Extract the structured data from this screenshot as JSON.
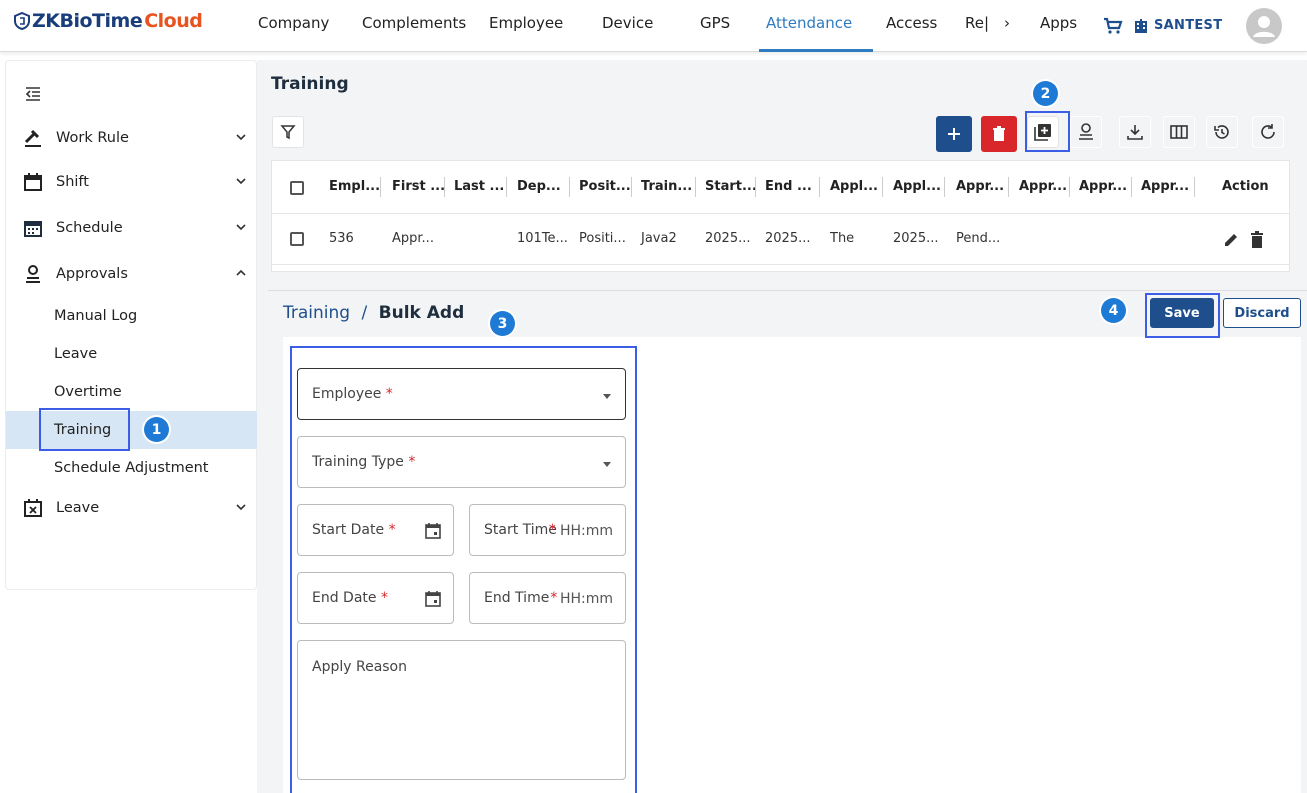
{
  "logo": {
    "part1": "ZKBioTime",
    "part2": "Cloud"
  },
  "nav": {
    "items": [
      "Company",
      "Complements",
      "Employee",
      "Device",
      "GPS",
      "Attendance",
      "Access",
      "Re|",
      "Apps"
    ],
    "more": "›",
    "company": "SANTEST",
    "active": "Attendance",
    "accent_color": "#2f7bbf"
  },
  "sidebar": {
    "groups": [
      {
        "label": "Work Rule",
        "icon": "gavel-icon"
      },
      {
        "label": "Shift",
        "icon": "calendar-blank-icon"
      },
      {
        "label": "Schedule",
        "icon": "calendar-grid-icon"
      },
      {
        "label": "Approvals",
        "icon": "user-stamp-icon"
      }
    ],
    "sub_items": [
      "Manual Log",
      "Leave",
      "Overtime",
      "Training",
      "Schedule Adjustment"
    ],
    "active_sub": "Training",
    "leave": {
      "label": "Leave",
      "icon": "calendar-x-icon"
    }
  },
  "main": {
    "title": "Training",
    "columns": [
      "Empl...",
      "First ...",
      "Last ...",
      "Dep...",
      "Posit...",
      "Train...",
      "Start...",
      "End ...",
      "Appl...",
      "Appl...",
      "Appr...",
      "Appr...",
      "Appr...",
      "Appr...",
      "Action"
    ],
    "rows": [
      [
        "536",
        "Appr...",
        "",
        "101Te...",
        "Positi...",
        "Java2",
        "2025...",
        "2025...",
        "The",
        "2025...",
        "Pend...",
        "",
        "",
        ""
      ]
    ]
  },
  "bulk": {
    "crumb_parent": "Training",
    "crumb_sep": "/",
    "crumb_current": "Bulk Add",
    "save": "Save",
    "discard": "Discard",
    "fields": {
      "employee": "Employee",
      "training_type": "Training Type",
      "start_date": "Start Date",
      "start_time": "Start Time",
      "start_time_placeholder": "HH:mm",
      "end_date": "End Date",
      "end_time": "End Time",
      "end_time_placeholder": "HH:mm",
      "apply_reason": "Apply Reason"
    },
    "required_mark": "*"
  },
  "annotations": {
    "b1": "1",
    "b2": "2",
    "b3": "3",
    "b4": "4",
    "highlight_color": "#3c5ee6",
    "badge_color": "#1f7ad6"
  },
  "colors": {
    "primary": "#1e4f8c",
    "danger": "#d8262b",
    "active_bg": "#d6e6f5"
  }
}
